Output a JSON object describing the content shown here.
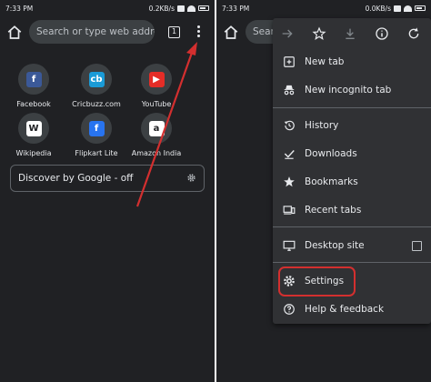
{
  "left": {
    "status": {
      "time": "7:33 PM",
      "speed": "0.2KB/s"
    },
    "omnibox": {
      "placeholder": "Search or type web address"
    },
    "tab_count": "1",
    "tiles": [
      {
        "label": "Facebook",
        "glyph": "f",
        "color": "#3b5998",
        "icon": "facebook-icon"
      },
      {
        "label": "Cricbuzz.com",
        "glyph": "cb",
        "color": "#1a9bd7",
        "icon": "cricbuzz-icon"
      },
      {
        "label": "YouTube",
        "glyph": "▶",
        "color": "#e52d27",
        "icon": "youtube-icon"
      },
      {
        "label": "Wikipedia",
        "glyph": "W",
        "color": "#ffffff",
        "icon": "wikipedia-icon"
      },
      {
        "label": "Flipkart Lite",
        "glyph": "f",
        "color": "#2874f0",
        "icon": "flipkart-icon"
      },
      {
        "label": "Amazon India",
        "glyph": "a",
        "color": "#ffffff",
        "icon": "amazon-icon"
      }
    ],
    "discover": {
      "label": "Discover by Google - off"
    }
  },
  "right": {
    "status": {
      "time": "7:33 PM",
      "speed": "0.0KB/s"
    },
    "omnibox": {
      "placeholder": "Sear"
    },
    "menu": {
      "items": [
        {
          "label": "New tab",
          "icon": "new-tab-icon"
        },
        {
          "label": "New incognito tab",
          "icon": "incognito-icon"
        },
        {
          "label": "History",
          "icon": "history-icon"
        },
        {
          "label": "Downloads",
          "icon": "downloads-icon"
        },
        {
          "label": "Bookmarks",
          "icon": "bookmarks-star-icon"
        },
        {
          "label": "Recent tabs",
          "icon": "recent-tabs-icon"
        },
        {
          "label": "Desktop site",
          "icon": "desktop-site-icon"
        },
        {
          "label": "Settings",
          "icon": "settings-gear-icon"
        },
        {
          "label": "Help & feedback",
          "icon": "help-icon"
        }
      ]
    }
  },
  "colors": {
    "bg": "#202124",
    "menu_bg": "#303134",
    "text": "#e8eaed",
    "annotation": "#d32f2f"
  }
}
